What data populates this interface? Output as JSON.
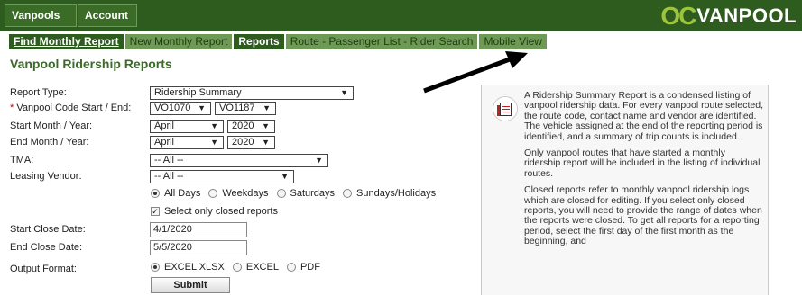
{
  "topbar": {
    "menus": [
      {
        "label": "Vanpools"
      },
      {
        "label": "Account"
      }
    ],
    "caret": "▼",
    "logo": {
      "oc": "OC",
      "vanpool": "VANPOOL"
    }
  },
  "tabs": [
    {
      "label": "Find Monthly Report"
    },
    {
      "label": "New Monthly Report"
    },
    {
      "label": "Reports"
    },
    {
      "label": "Route - Passenger List - Rider Search"
    },
    {
      "label": "Mobile View"
    }
  ],
  "page_title": "Vanpool Ridership Reports",
  "form": {
    "report_type": {
      "label": "Report Type:",
      "value": "Ridership Summary"
    },
    "vanpool_code": {
      "required_mark": "*",
      "label": " Vanpool Code Start / End:",
      "start": "VO1070",
      "end": "VO1187"
    },
    "start_month": {
      "label": "Start Month / Year:",
      "month": "April",
      "year": "2020"
    },
    "end_month": {
      "label": "End Month / Year:",
      "month": "April",
      "year": "2020"
    },
    "tma": {
      "label": "TMA:",
      "value": "-- All --"
    },
    "leasing_vendor": {
      "label": "Leasing Vendor:",
      "value": "-- All --"
    },
    "days": {
      "options": [
        "All Days",
        "Weekdays",
        "Saturdays",
        "Sundays/Holidays"
      ],
      "selected": "All Days"
    },
    "closed_only": {
      "label": "Select only closed reports",
      "checked": true
    },
    "start_close_date": {
      "label": "Start Close Date:",
      "value": "4/1/2020"
    },
    "end_close_date": {
      "label": "End Close Date:",
      "value": "5/5/2020"
    },
    "output_format": {
      "label": "Output Format:",
      "options": [
        "EXCEL XLSX",
        "EXCEL",
        "PDF"
      ],
      "selected": "EXCEL XLSX"
    },
    "submit_label": "Submit"
  },
  "info": {
    "icon": "report-document-icon",
    "paragraphs": [
      "A Ridership Summary Report is a condensed listing of vanpool ridership data. For every vanpool route selected, the route code, contact name and vendor are identified. The vehicle assigned at the end of the reporting period is identified, and a summary of trip counts is included.",
      "Only vanpool routes that have started a monthly ridership report will be included in the listing of individual routes.",
      "Closed reports refer to monthly vanpool ridership logs which are closed for editing. If you select only closed reports, you will need to provide the range of dates when the reports were closed. To get all reports for a reporting period, select the first day of the first month as the beginning, and"
    ]
  },
  "colors": {
    "brand_dark": "#2e5c1e",
    "brand_light": "#9bc53d",
    "tab_inactive": "#6f9a55"
  }
}
